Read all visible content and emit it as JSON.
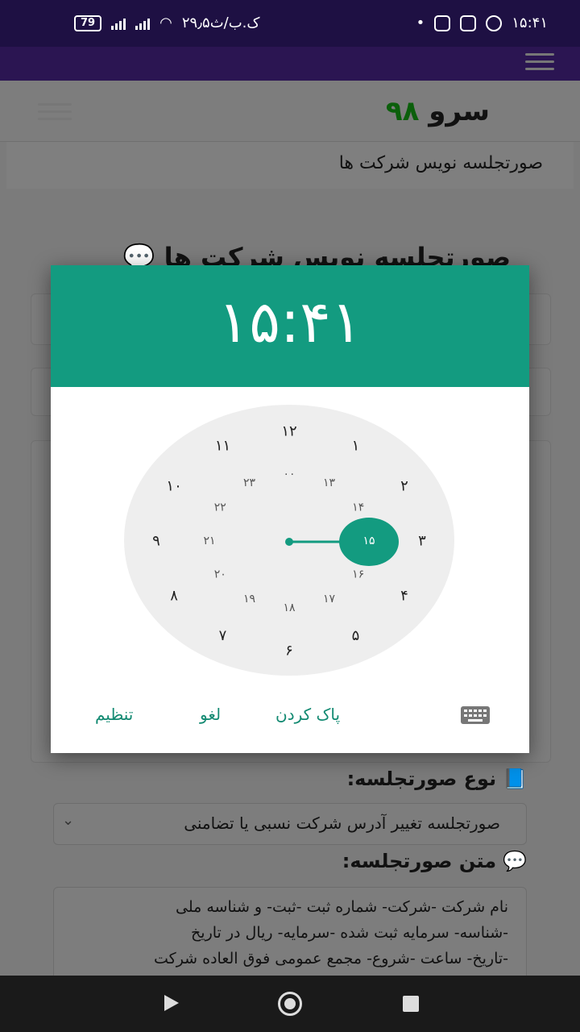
{
  "status_bar": {
    "time": "۱۵:۴۱",
    "battery": "79",
    "network_speed": "۲۹٫۵ک.ب/ث"
  },
  "site": {
    "brand_name": "سرو",
    "brand_number": "۹۸",
    "subtitle": "صورتجلسه نویس شرکت ها",
    "page_heading": "صورتجلسه نویس شرکت ها"
  },
  "form": {
    "type_label": "نوع صورتجلسه:",
    "type_value": "صورتجلسه تغییر آدرس شرکت نسبی یا تضامنی",
    "text_label": "متن صورتجلسه:",
    "text_lines": [
      "نام شرکت -شرکت- شماره ثبت -ثبت- و شناسه ملی",
      "-شناسه- سرمایه ثبت شده -سرمایه- ریال در تاریخ",
      "-تاریخ- ساعت -شروع- مجمع عمومی فوق العاده شرکت"
    ]
  },
  "time_picker": {
    "time": "۱۵:۴۱",
    "selected": "۱۵",
    "outer_hours": [
      "۱۲",
      "۱",
      "۲",
      "۳",
      "۴",
      "۵",
      "۶",
      "۷",
      "۸",
      "۹",
      "۱۰",
      "۱۱"
    ],
    "inner_hours": [
      "۰۰",
      "۱۳",
      "۱۴",
      "۱۵",
      "۱۶",
      "۱۷",
      "۱۸",
      "۱۹",
      "۲۰",
      "۲۱",
      "۲۲",
      "۲۳"
    ],
    "set_label": "تنظیم",
    "cancel_label": "لغو",
    "clear_label": "پاک کردن",
    "accent": "#139b80"
  },
  "icons": {
    "keyboard": "keyboard-icon",
    "menu": "menu-icon",
    "chat": "chat-bubble-icon",
    "book": "book-icon"
  }
}
